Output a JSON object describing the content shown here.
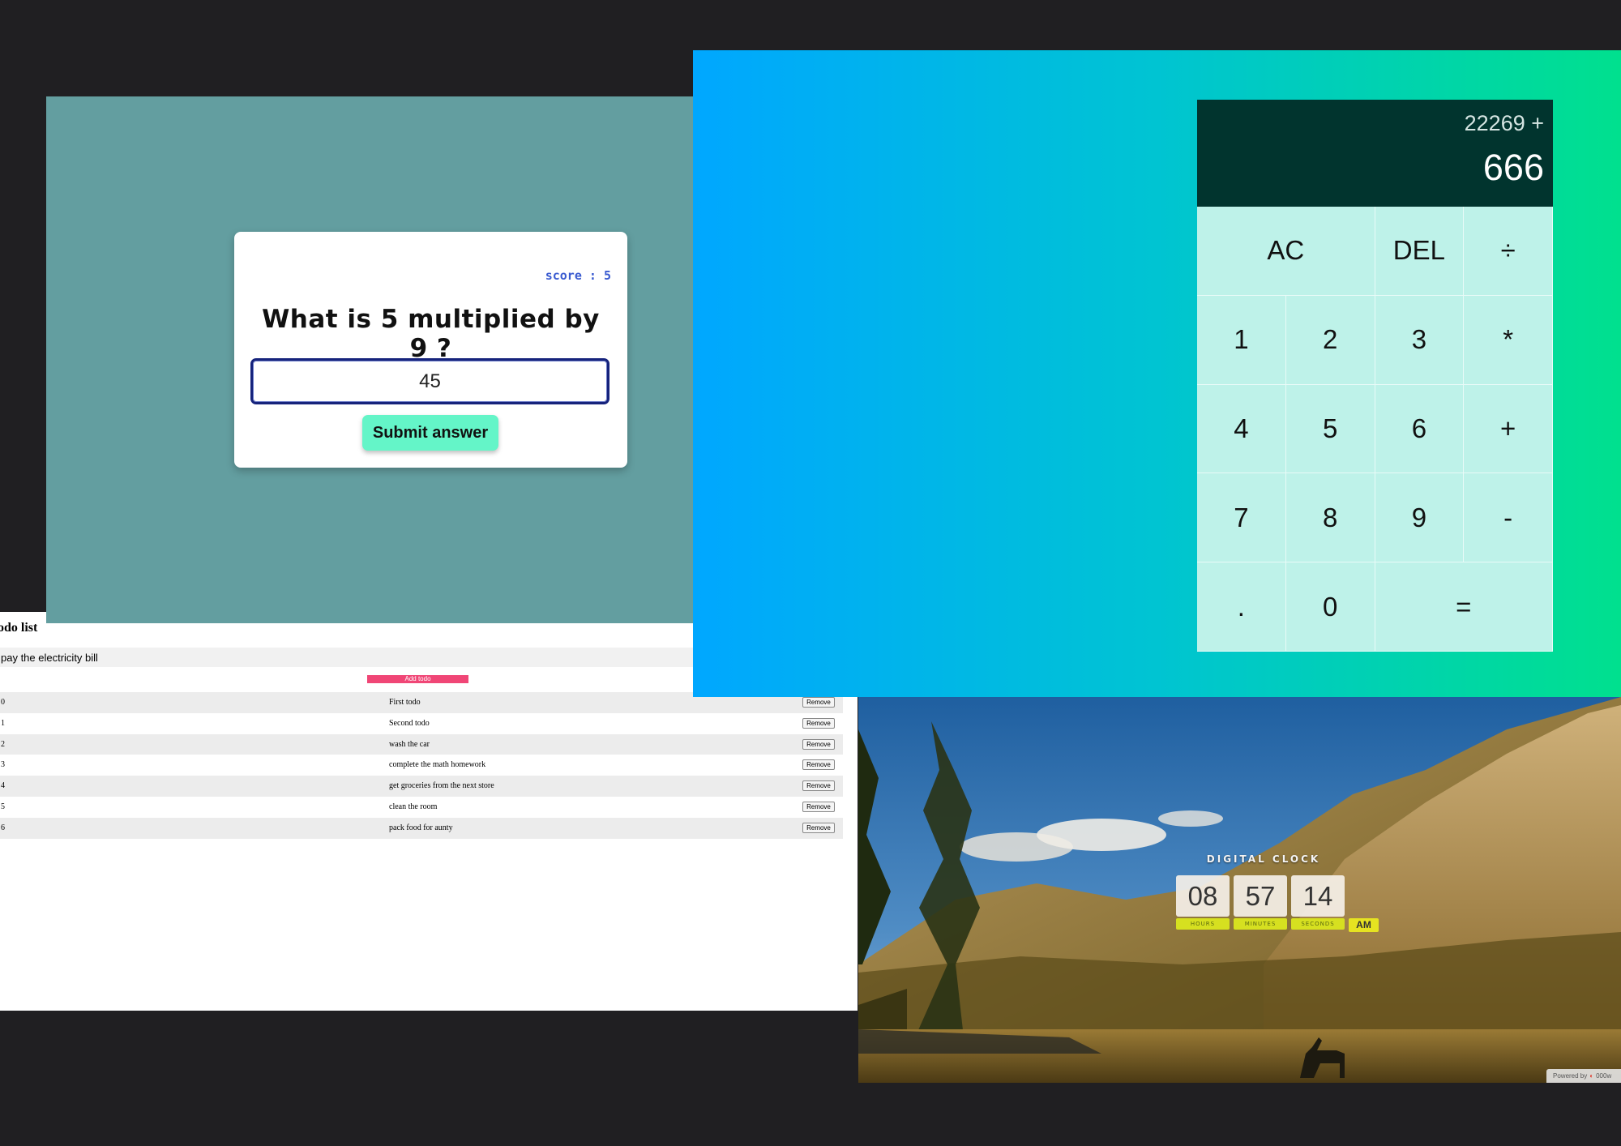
{
  "todo": {
    "title": "odo list",
    "input_value": "pay the electricity bill",
    "add_button": "Add todo",
    "remove_label": "Remove",
    "items": [
      {
        "index": "0",
        "text": "First todo"
      },
      {
        "index": "1",
        "text": "Second todo"
      },
      {
        "index": "2",
        "text": "wash the car"
      },
      {
        "index": "3",
        "text": "complete the math homework"
      },
      {
        "index": "4",
        "text": "get groceries from the next store"
      },
      {
        "index": "5",
        "text": "clean the room"
      },
      {
        "index": "6",
        "text": "pack food for aunty"
      }
    ]
  },
  "quiz": {
    "score_text": "score : 5",
    "question": "What is 5 multiplied by 9 ?",
    "answer_value": "45",
    "submit_label": "Submit answer"
  },
  "calculator": {
    "previous_operand": "22269 +",
    "current_operand": "666",
    "keys": [
      "AC",
      "DEL",
      "÷",
      "1",
      "2",
      "3",
      "*",
      "4",
      "5",
      "6",
      "+",
      "7",
      "8",
      "9",
      "-",
      ".",
      "0",
      "="
    ]
  },
  "clock": {
    "title": "DIGITAL CLOCK",
    "hours": "08",
    "minutes": "57",
    "seconds": "14",
    "hours_label": "HOURS",
    "minutes_label": "MINUTES",
    "seconds_label": "SECONDS",
    "ampm": "AM",
    "powered_by": "Powered by",
    "powered_brand": "000w"
  },
  "colors": {
    "desktop_bg": "#201f22",
    "quiz_bg": "#639ea0",
    "quiz_submit": "#64f5c8",
    "calc_display": "#01342e",
    "calc_keys": "#bef2e9",
    "todo_add": "#f04676",
    "clock_label": "#d6e020"
  }
}
